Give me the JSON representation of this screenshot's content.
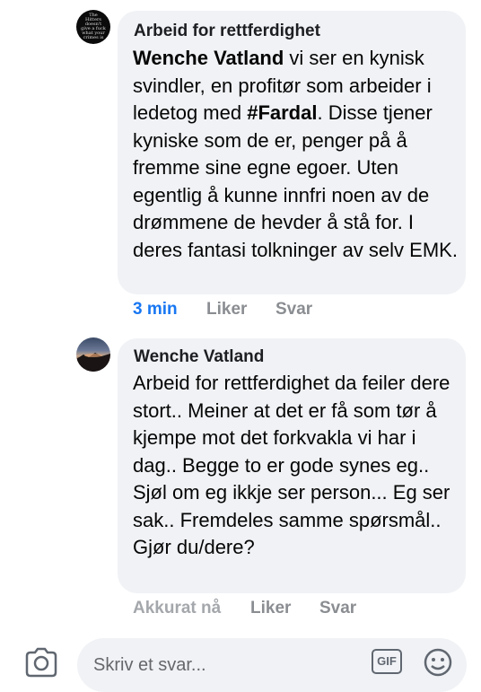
{
  "comments": [
    {
      "author": "Arbeid for rettferdighet",
      "avatar_icon": "page-logo-icon",
      "avatar_text": "The Hitters doesn't give a fuck what your crimes is",
      "mention": "Wenche Vatland",
      "text_part1": " vi ser en kynisk svindler, en profitør som arbeider i ledetog med ",
      "hashtag": "#Fardal",
      "text_part2": ". Disse tjener kyniske som de er, penger på å fremme sine egne egoer. Uten egentlig å kunne innfri noen av de drømmene de hevder å stå for. I deres fantasi tolkninger av selv EMK.",
      "time": "3 min",
      "like": "Liker",
      "reply": "Svar"
    },
    {
      "author": "Wenche Vatland",
      "avatar_icon": "sunset-avatar",
      "text": "Arbeid for rettferdighet da feiler dere stort.. Meiner at det er få som tør å kjempe mot det forkvakla vi har i dag.. Begge to er gode synes eg.. Sjøl om eg ikkje ser person... Eg ser sak.. Fremdeles samme spørsmål.. Gjør du/dere?",
      "time": "Akkurat nå",
      "like": "Liker",
      "reply": "Svar"
    }
  ],
  "composer": {
    "placeholder": "Skriv et svar...",
    "gif_label": "GIF",
    "camera_icon": "camera-icon",
    "emoji_icon": "emoji-icon"
  },
  "colors": {
    "bubble": "#f0f2f5",
    "link_time": "#1877f2",
    "meta_gray": "#8a8d91"
  }
}
